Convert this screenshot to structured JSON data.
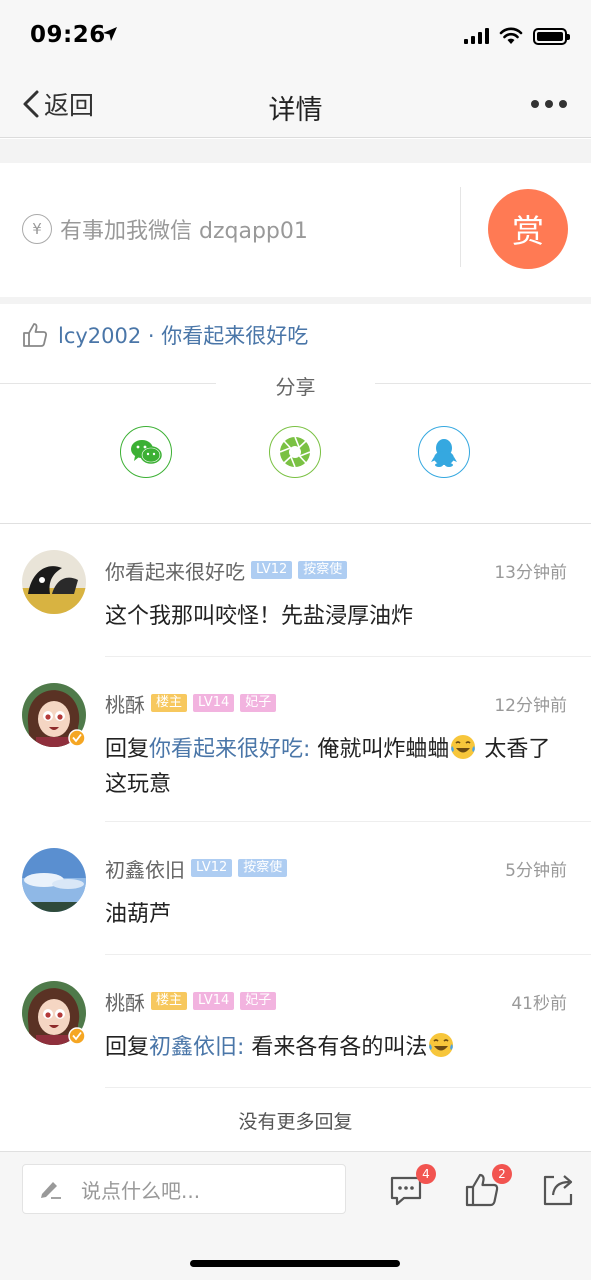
{
  "status_bar": {
    "time": "09:26"
  },
  "nav": {
    "back_label": "返回",
    "title": "详情"
  },
  "reward": {
    "text": "有事加我微信 dzqapp01",
    "button_label": "赏",
    "currency_symbol": "¥"
  },
  "likes": {
    "text": "lcy2002 · 你看起来很好吃"
  },
  "share": {
    "title": "分享",
    "targets": [
      {
        "name": "wechat",
        "color": "#3cb034"
      },
      {
        "name": "moments",
        "color": "#7ac143"
      },
      {
        "name": "qq",
        "color": "#35a8e0"
      }
    ]
  },
  "comments": [
    {
      "name": "你看起来很好吃",
      "badges": [
        "LV12",
        "按察使"
      ],
      "time": "13分钟前",
      "body": "这个我那叫咬怪！先盐浸厚油炸"
    },
    {
      "name": "桃酥",
      "badges": [
        "楼主",
        "LV14",
        "妃子"
      ],
      "time": "12分钟前",
      "reply_prefix": "回复",
      "reply_to": "你看起来很好吃:",
      "body": " 俺就叫炸蛐蛐",
      "body_tail": " 太香了这玩意"
    },
    {
      "name": "初鑫依旧",
      "badges": [
        "LV12",
        "按察使"
      ],
      "time": "5分钟前",
      "body": "油葫芦"
    },
    {
      "name": "桃酥",
      "badges": [
        "楼主",
        "LV14",
        "妃子"
      ],
      "time": "41秒前",
      "reply_prefix": "回复",
      "reply_to": "初鑫依旧:",
      "body": " 看来各有各的叫法"
    }
  ],
  "no_more": "没有更多回复",
  "bottom_bar": {
    "input_placeholder": "说点什么吧...",
    "comment_count": "4",
    "like_count": "2"
  },
  "colors": {
    "accent": "#4a76a8",
    "reward": "#ff7a54",
    "badge_red": "#f25450"
  }
}
